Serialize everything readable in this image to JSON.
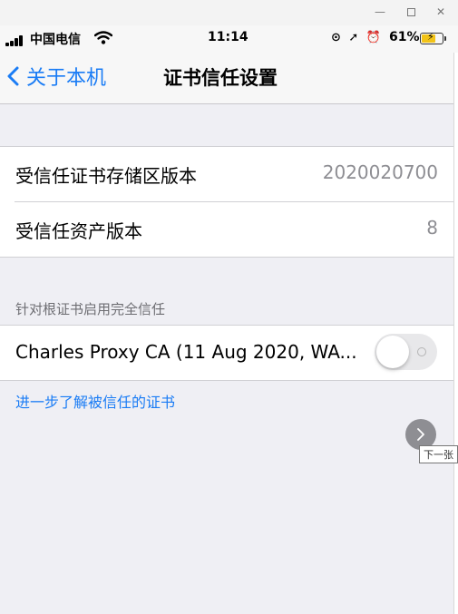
{
  "window": {
    "minimize_glyph": "—",
    "close_glyph": "✕"
  },
  "status_bar": {
    "carrier": "中国电信",
    "time": "11:14",
    "indicators": "⊙ ➚ ⏰",
    "battery": "61%",
    "battery_level": 0.61,
    "battery_color": "#f2c317"
  },
  "nav": {
    "back_label": "关于本机",
    "title": "证书信任设置"
  },
  "info_rows": [
    {
      "label": "受信任证书存储区版本",
      "value": "2020020700"
    },
    {
      "label": "受信任资产版本",
      "value": "8"
    }
  ],
  "trust_section": {
    "header": "针对根证书启用完全信任",
    "certificate": "Charles Proxy CA (11 Aug 2020, WA...",
    "enabled": false,
    "footer_link": "进一步了解被信任的证书"
  },
  "viewer": {
    "next_tooltip": "下一张"
  },
  "colors": {
    "accent": "#1a7cf5",
    "background": "#efeff4",
    "secondary_text": "#8e8e93"
  }
}
